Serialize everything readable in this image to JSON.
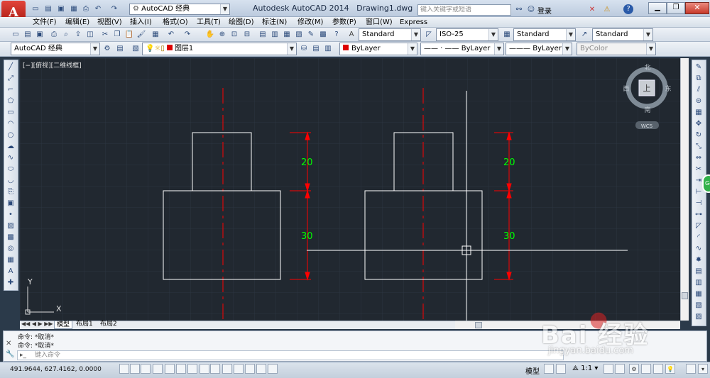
{
  "titlebar": {
    "workspace": "AutoCAD 经典",
    "app_title": "Autodesk AutoCAD 2014",
    "doc_title": "Drawing1.dwg",
    "search_placeholder": "键入关键字或短语",
    "login": "登录",
    "help": "?"
  },
  "menu": [
    "文件(F)",
    "编辑(E)",
    "视图(V)",
    "插入(I)",
    "格式(O)",
    "工具(T)",
    "绘图(D)",
    "标注(N)",
    "修改(M)",
    "参数(P)",
    "窗口(W)",
    "Express"
  ],
  "styles": {
    "text_style": "Standard",
    "dim_style": "ISO-25",
    "table_style": "Standard",
    "mleader_style": "Standard"
  },
  "layers": {
    "workspace": "AutoCAD 经典",
    "current_layer": "图层1",
    "color": "ByLayer",
    "linetype": "ByLayer",
    "lineweight": "ByLayer",
    "plotstyle": "ByColor"
  },
  "viewport": {
    "label": "[−][俯视][二维线框]",
    "viewcube": {
      "north": "北",
      "south": "南",
      "east": "东",
      "west": "西",
      "top": "上",
      "wcs": "WCS"
    },
    "ucs": {
      "x": "X",
      "y": "Y"
    }
  },
  "drawing": {
    "dims": [
      "20",
      "30",
      "20",
      "30"
    ],
    "colors": {
      "geometry": "#ffffff",
      "centerline": "#ff0000",
      "dimline": "#ff0000",
      "dimtext": "#00ff00"
    }
  },
  "tabs": [
    "模型",
    "布局1",
    "布局2"
  ],
  "command": {
    "history": [
      "命令: *取消*",
      "命令: *取消*"
    ],
    "placeholder": "键入命令"
  },
  "status": {
    "coords": "491.9644, 627.4162, 0.0000",
    "model": "模型",
    "scale": "1:1"
  },
  "watermark": {
    "brand": "Bai 经验",
    "url": "jingyan.baidu.com"
  }
}
